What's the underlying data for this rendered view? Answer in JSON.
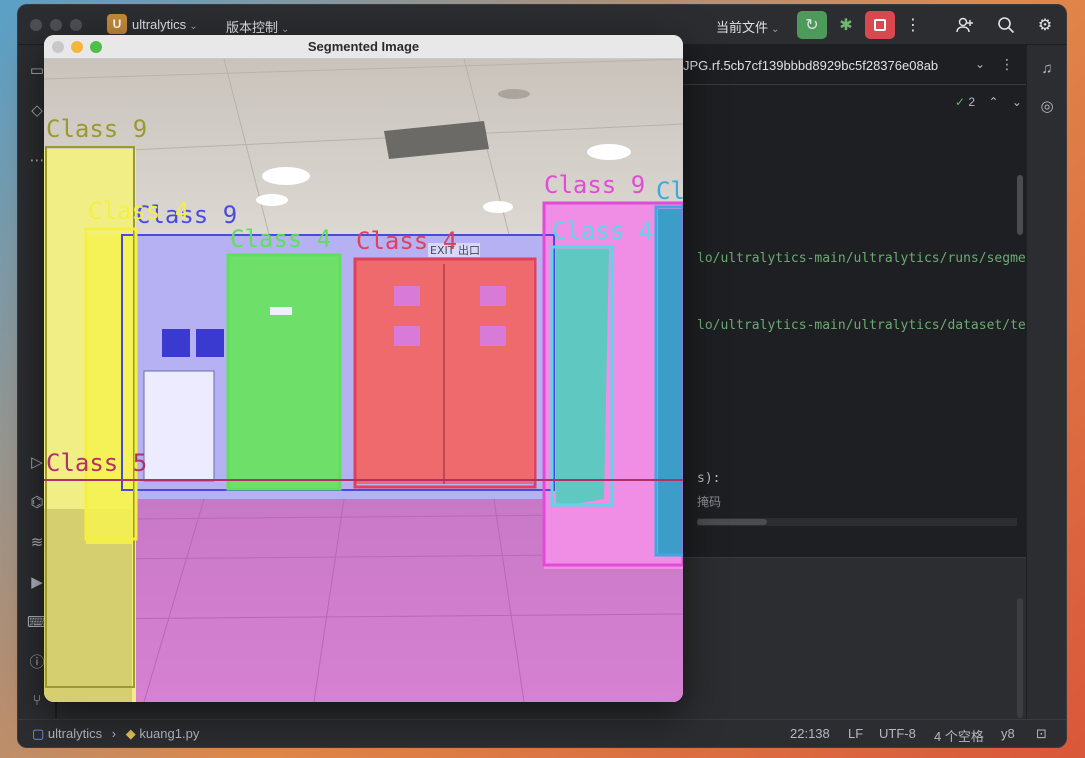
{
  "titlebar": {
    "project_badge": "U",
    "project_name": "ultralytics",
    "vcs_menu": "版本控制",
    "run_config": "当前文件",
    "icons": [
      "run-icon",
      "debug-icon",
      "stop-icon",
      "more-icon",
      "add-user-icon",
      "search-icon",
      "settings-icon"
    ]
  },
  "editor": {
    "tab_name": "JPG.rf.5cb7cf139bbbd8929bc5f28376e08ab",
    "problems_count": "2",
    "code_lines": [
      "lo/ultralytics-main/ultralytics/runs/segment",
      "lo/ultralytics-main/ultralytics/dataset/test",
      "s):",
      "掩码"
    ]
  },
  "status_bar": {
    "breadcrumb_project": "ultralytics",
    "breadcrumb_file": "kuang1.py",
    "cursor": "22:138",
    "line_sep": "LF",
    "encoding": "UTF-8",
    "indent": "4 个空格",
    "interpreter": "y8"
  },
  "seg_window": {
    "title": "Segmented Image",
    "labels": {
      "class9_left": "Class 9",
      "class4_yellow": "Class 4",
      "class9_blue": "Class 9",
      "class4_green": "Class 4",
      "class4_red": "Class 4",
      "class9_magenta": "Class 9",
      "class4_cyan": "Class 4",
      "class_partial": "Cl",
      "class5": "Class 5",
      "exit_sign": "EXIT 出口"
    },
    "colors": {
      "class9_left": "#9a9a2e",
      "class4_yellow": "#f4f040",
      "class9_blue": "#4a4ae0",
      "class4_green": "#5ee05a",
      "class4_red": "#e0405a",
      "class9_magenta": "#e24ad8",
      "class4_cyan": "#5ad8e8",
      "class5": "#b0306a"
    }
  }
}
